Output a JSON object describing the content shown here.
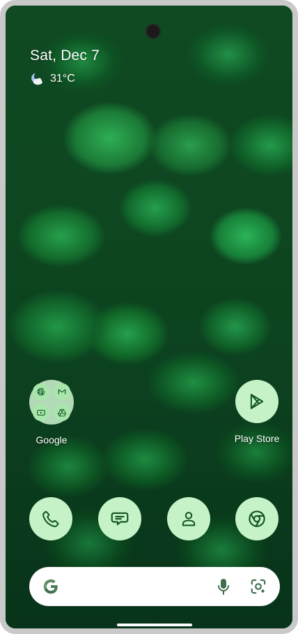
{
  "status": {
    "date": "Sat, Dec 7",
    "temperature": "31°C",
    "weather_icon": "moon-cloud-icon"
  },
  "home": {
    "folder": {
      "label": "Google",
      "apps": [
        "google-icon",
        "gmail-icon",
        "youtube-icon",
        "drive-icon"
      ]
    },
    "play_store": {
      "label": "Play Store",
      "icon": "play-store-icon"
    }
  },
  "dock": [
    {
      "name": "phone",
      "icon": "phone-icon"
    },
    {
      "name": "messages",
      "icon": "messages-icon"
    },
    {
      "name": "contacts",
      "icon": "contacts-icon"
    },
    {
      "name": "chrome",
      "icon": "chrome-icon"
    }
  ],
  "search": {
    "logo": "google-g-icon",
    "voice": "microphone-icon",
    "lens": "lens-icon"
  },
  "colors": {
    "icon_bg": "#c5f2c7",
    "icon_fg": "#0f5223",
    "wallpaper": "#0f4a22"
  }
}
